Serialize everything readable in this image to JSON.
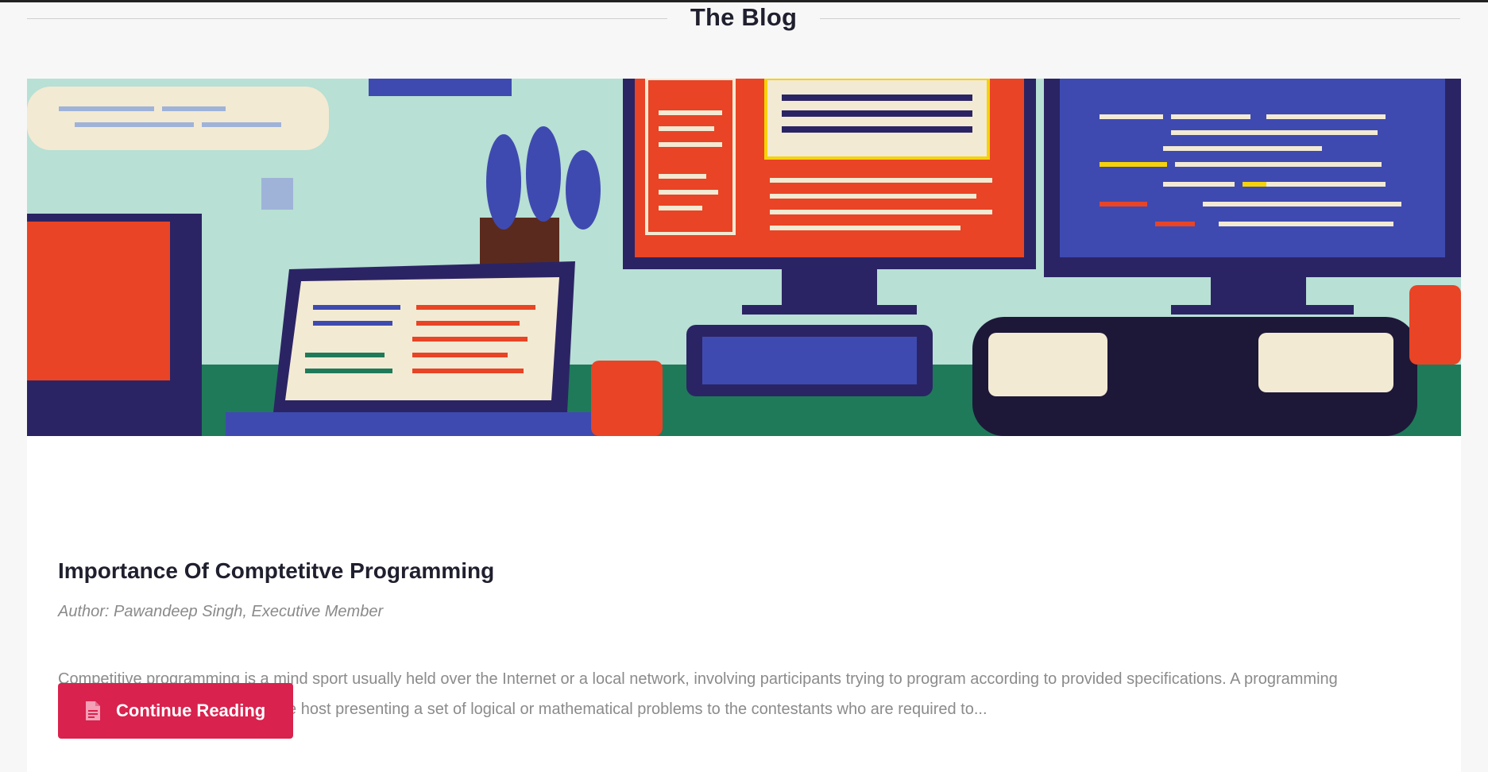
{
  "section": {
    "title": "The Blog"
  },
  "post": {
    "image_alt": "Illustration of programming desk with monitors, laptops and keyboards",
    "title": "Importance Of Comptetitve Programming",
    "author": "Author: Pawandeep Singh, Executive Member",
    "excerpt": "Competitive programming is a mind sport usually held over the Internet or a local network, involving participants trying to program according to provided specifications. A programming competition generally involves the host presenting a set of logical or mathematical problems to the contestants who are required to...",
    "button_label": "Continue Reading",
    "button_icon": "document-icon"
  },
  "colors": {
    "accent": "#d9224e",
    "title": "#1f1f2e",
    "muted": "#8b8b8b",
    "background": "#f7f7f7"
  }
}
